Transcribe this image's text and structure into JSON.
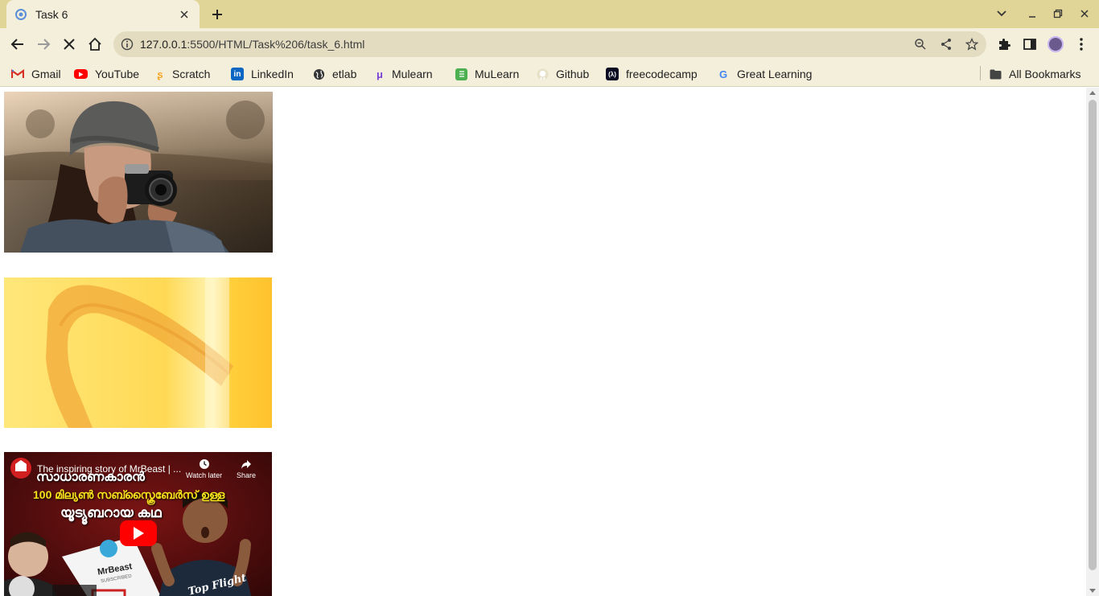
{
  "tab": {
    "title": "Task 6"
  },
  "address": {
    "host": "127.0.0.1",
    "path": ":5500/HTML/Task%206/task_6.html"
  },
  "bookmarks": [
    {
      "label": "Gmail",
      "icon": "gmail-icon"
    },
    {
      "label": "YouTube",
      "icon": "youtube-icon"
    },
    {
      "label": "Scratch",
      "icon": "scratch-icon"
    },
    {
      "label": "LinkedIn",
      "icon": "linkedin-icon"
    },
    {
      "label": "etlab",
      "icon": "globe-icon"
    },
    {
      "label": "Mulearn",
      "icon": "mulearn-icon"
    },
    {
      "label": "MuLearn",
      "icon": "mulearn-green-icon"
    },
    {
      "label": "Github",
      "icon": "github-icon"
    },
    {
      "label": "freecodecamp",
      "icon": "freecodecamp-icon"
    },
    {
      "label": "Great Learning",
      "icon": "google-icon"
    }
  ],
  "all_bookmarks": "All Bookmarks",
  "video": {
    "title": "The inspiring story of MrBeast | ...",
    "line1": "സാധാരണകാരൻ",
    "line2": "100 മില്യൺ സബ്സ്ക്രൈബേർസ് ഉള്ള",
    "line3": "യൂട്യൂബറായ കഥ",
    "watch_later": "Watch later",
    "share": "Share",
    "channel_card": "MrBeast",
    "subscribed": "SUBSCRIBED",
    "shirt_text": "Top Flight"
  },
  "colors": {
    "tabstrip": "#e0d596",
    "toolbar": "#f3efdb",
    "omnibox": "#e3dcc0"
  }
}
